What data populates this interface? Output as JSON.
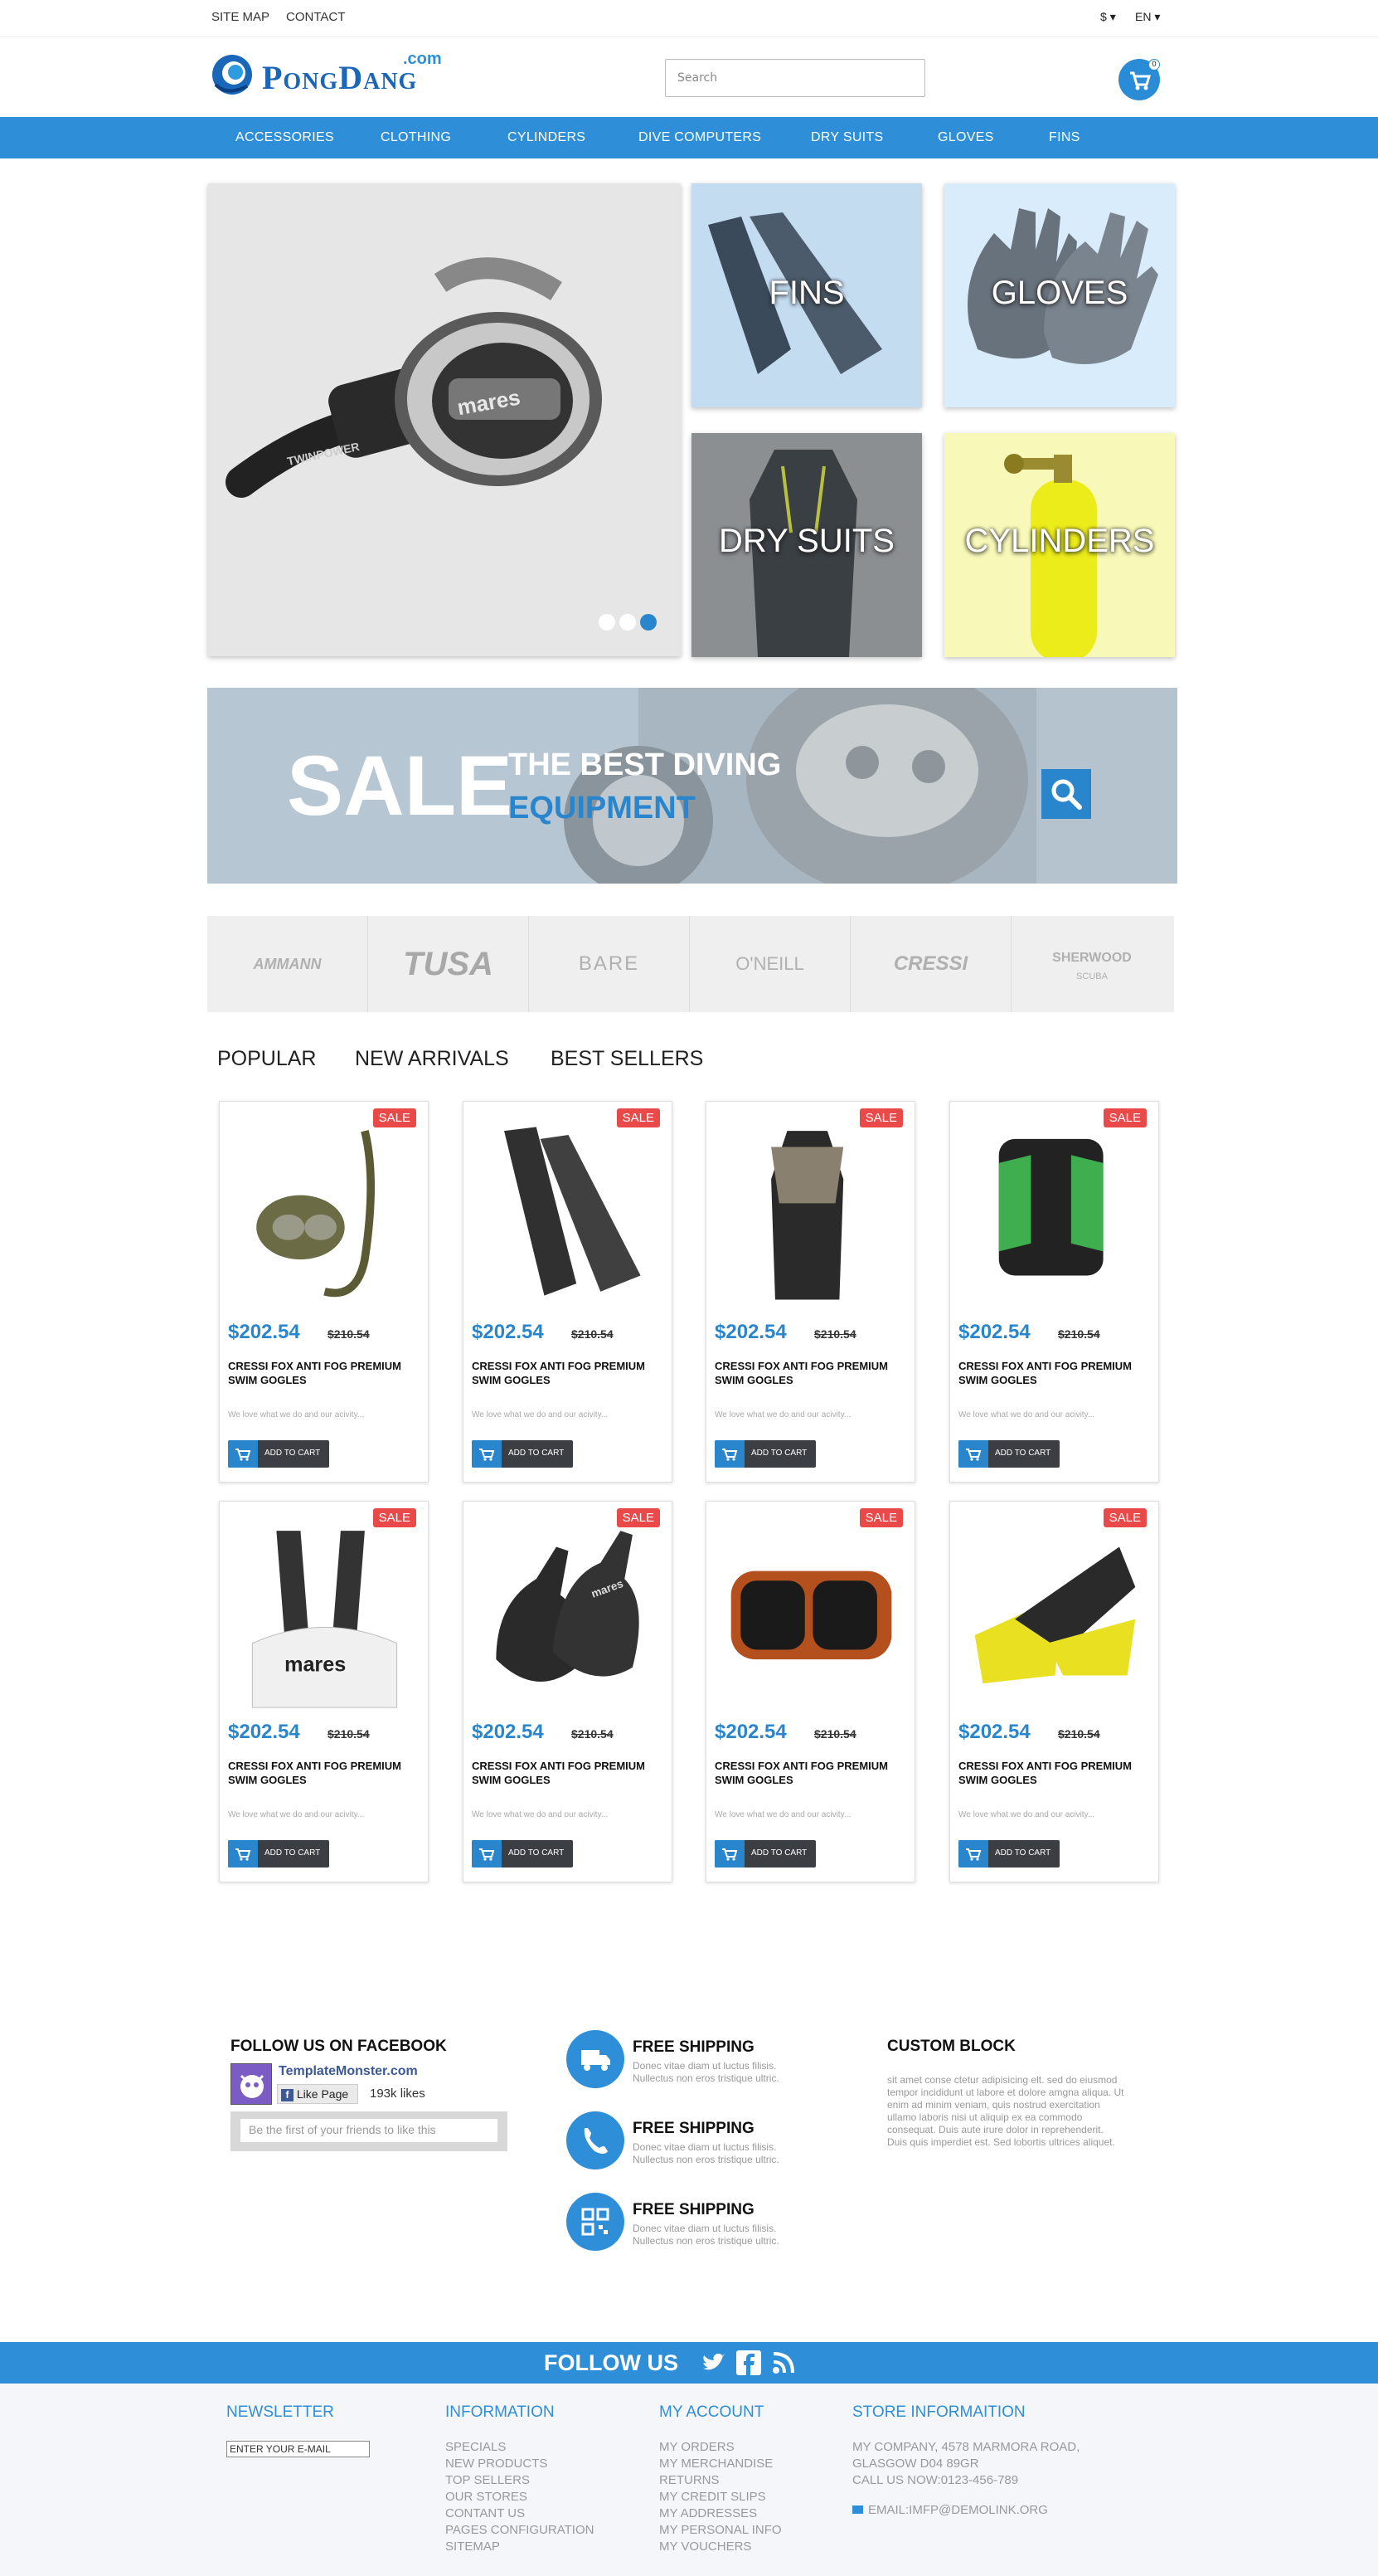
{
  "topbar": {
    "links": [
      "SITE MAP",
      "CONTACT"
    ],
    "currency": "$",
    "language": "EN"
  },
  "header": {
    "logo_text": "PongDang",
    "logo_suffix": ".com",
    "search_placeholder": "Search",
    "cart_count": "0"
  },
  "nav": {
    "items": [
      "ACCESSORIES",
      "CLOTHING",
      "CYLINDERS",
      "DIVE COMPUTERS",
      "DRY SUITS",
      "GLOVES",
      "FINS"
    ]
  },
  "hero": {
    "tiles": [
      "FINS",
      "GLOVES",
      "DRY SUITS",
      "CYLINDERS"
    ],
    "slider_dots": 3,
    "active_dot": 3,
    "regulator_brand": "mares",
    "regulator_model": "TWINPOWER"
  },
  "banner": {
    "big": "SALE",
    "line1": "THE BEST DIVING",
    "line2": "EQUIPMENT"
  },
  "brands": [
    "AMMANN",
    "TUSA",
    "BARE",
    "O'NEILL",
    "CRESSI",
    "SHERWOOD"
  ],
  "brand_sub": "SCUBA",
  "tabs": [
    "POPULAR",
    "NEW ARRIVALS",
    "BEST SELLERS"
  ],
  "product_common": {
    "sale": "SALE",
    "price": "$202.54",
    "old_price": "$210.54",
    "name": "CRESSI FOX ANTI FOG PREMIUM SWIM GOGLES",
    "desc": "We love what we do and our acivity...",
    "button": "ADD TO CART"
  },
  "products": [
    {
      "image": "snorkel-mask"
    },
    {
      "image": "fins-pair"
    },
    {
      "image": "drysuit"
    },
    {
      "image": "bcd-vest"
    },
    {
      "image": "monofin-mares"
    },
    {
      "image": "gloves-mares"
    },
    {
      "image": "dive-mask"
    },
    {
      "image": "yellow-fins"
    }
  ],
  "product_labels": {
    "monofin": "mares"
  },
  "facebook": {
    "title": "FOLLOW US ON FACEBOOK",
    "page": "TemplateMonster.com",
    "like": "Like Page",
    "likes": "193k likes",
    "first": "Be the first of your friends to like this"
  },
  "features": [
    {
      "title": "FREE SHIPPING",
      "text1": "Donec vitae diam ut luctus filisis.",
      "text2": "Nullectus non eros tristique ultric.",
      "icon": "truck-icon"
    },
    {
      "title": "FREE SHIPPING",
      "text1": "Donec vitae diam ut luctus filisis.",
      "text2": "Nullectus non eros tristique ultric.",
      "icon": "phone-icon"
    },
    {
      "title": "FREE SHIPPING",
      "text1": "Donec vitae diam ut luctus filisis.",
      "text2": "Nullectus non eros tristique ultric.",
      "icon": "qr-icon"
    }
  ],
  "custom_block": {
    "title": "CUSTOM BLOCK",
    "lines": [
      "sit amet conse ctetur adipisicing elt. sed do eiusmod",
      "tempor incididunt ut labore et dolore amgna aliqua. Ut",
      "enim ad minim veniam, quis nostrud exercitation",
      "ullamo laboris nisi ut aliquip ex ea commodo",
      "consequat. Duis aute irure dolor in reprehenderit.",
      "Duis quis imperdiet est. Sed lobortis ultrices aliquet."
    ]
  },
  "follow_bar": {
    "label": "FOLLOW US"
  },
  "footer": {
    "newsletter": {
      "title": "NEWSLETTER",
      "placeholder": "ENTER YOUR E-MAIL"
    },
    "information": {
      "title": "INFORMATION",
      "items": [
        "SPECIALS",
        "NEW PRODUCTS",
        "TOP SELLERS",
        "OUR STORES",
        "CONTANT US",
        "PAGES CONFIGURATION",
        "SITEMAP"
      ]
    },
    "account": {
      "title": "MY ACCOUNT",
      "items": [
        "MY ORDERS",
        "MY MERCHANDISE",
        "RETURNS",
        "MY CREDIT SLIPS",
        "MY ADDRESSES",
        "MY PERSONAL INFO",
        "MY VOUCHERS"
      ]
    },
    "store": {
      "title": "STORE INFORMAITION",
      "lines": [
        "MY COMPANY, 4578 MARMORA ROAD,",
        "GLASGOW D04 89GR",
        "CALL US NOW:0123-456-789"
      ],
      "email": "EMAIL:IMFP@DEMOLINK.ORG"
    }
  },
  "colors": {
    "accent": "#2e8ed8",
    "sale": "#e94949",
    "price": "#2a86cc",
    "button": "#3b3f44"
  }
}
